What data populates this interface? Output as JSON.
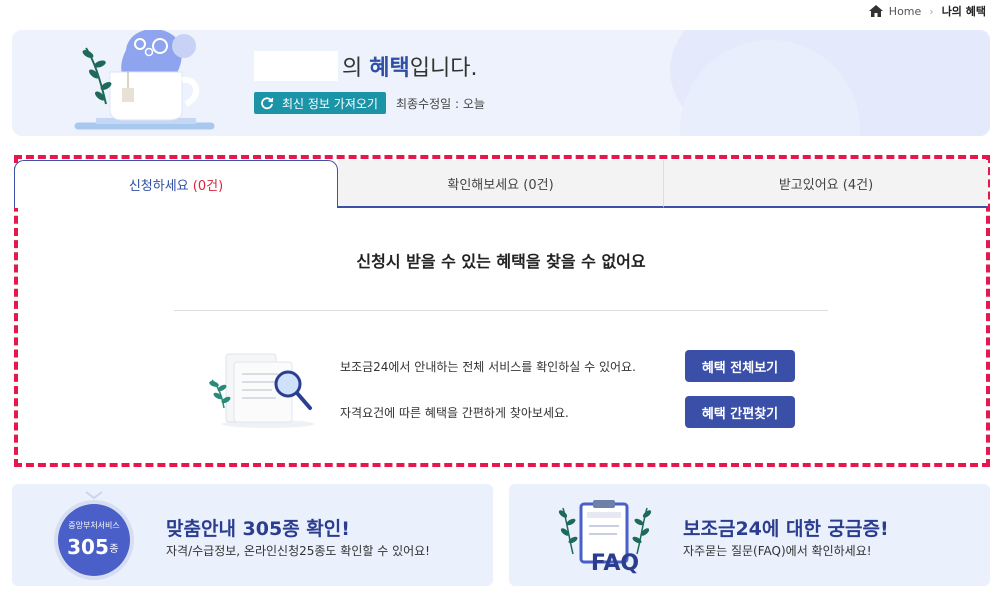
{
  "breadcrumb": {
    "home": "Home",
    "current": "나의 혜택"
  },
  "header": {
    "title_suffix": "의 ",
    "title_bold": "혜택",
    "title_end": "입니다.",
    "refresh_label": "최신 정보 가져오기",
    "updated_text": "최종수정일 : 오늘"
  },
  "tabs": [
    {
      "label": "신청하세요",
      "count": "(0건)"
    },
    {
      "label": "확인해보세요",
      "count": "(0건)"
    },
    {
      "label": "받고있어요",
      "count": "(4건)"
    }
  ],
  "main": {
    "empty_message": "신청시 받을 수 있는 혜택을 찾을 수 없어요",
    "info_line_1": "보조금24에서 안내하는 전체 서비스를 확인하실 수 있어요.",
    "info_line_2": "자격요건에 따른 혜택을 간편하게 찾아보세요.",
    "btn_all": "혜택 전체보기",
    "btn_find": "혜택 간편찾기"
  },
  "cards": {
    "guide": {
      "badge_top": "중앙부처서비스",
      "badge_number": "305",
      "badge_unit": "종",
      "title": "맞춤안내 305종 확인!",
      "subtitle": "자격/수급정보, 온라인신청25종도 확인할 수 있어요!"
    },
    "faq": {
      "label": "FAQ",
      "title": "보조금24에 대한 궁금증!",
      "subtitle": "자주묻는 질문(FAQ)에서 확인하세요!"
    }
  },
  "colors": {
    "accent": "#3a4fa8",
    "teal": "#1c94a8",
    "highlight": "#e5174d",
    "banner_bg": "#eef2fc"
  }
}
